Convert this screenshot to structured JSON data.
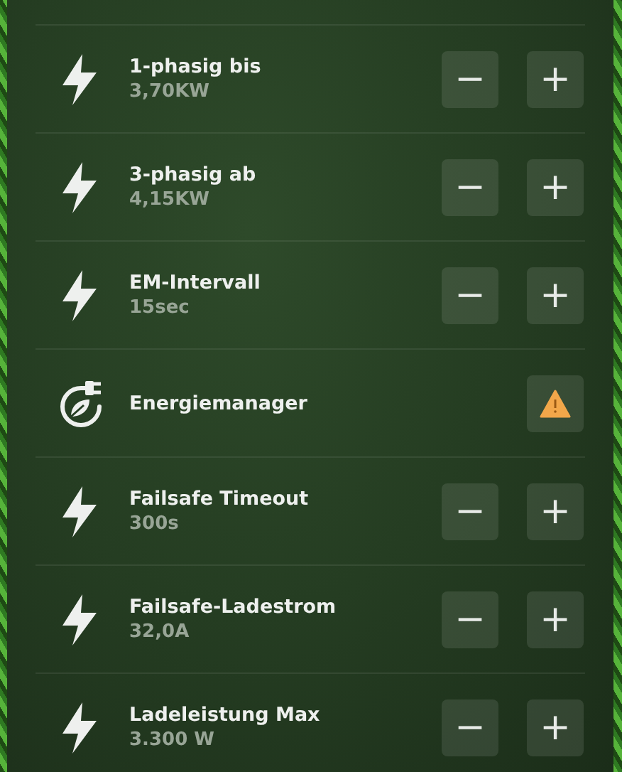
{
  "settings": [
    {
      "kind": "stepper",
      "title": "1-phasig bis",
      "value": "3,70KW",
      "minus": "−",
      "plus": "+"
    },
    {
      "kind": "stepper",
      "title": "3-phasig ab",
      "value": "4,15KW",
      "minus": "−",
      "plus": "+"
    },
    {
      "kind": "stepper",
      "title": "EM-Intervall",
      "value": "15sec",
      "minus": "−",
      "plus": "+"
    },
    {
      "kind": "warning",
      "title": "Energiemanager"
    },
    {
      "kind": "stepper",
      "title": "Failsafe Timeout",
      "value": "300s",
      "minus": "−",
      "plus": "+"
    },
    {
      "kind": "stepper",
      "title": "Failsafe-Ladestrom",
      "value": "32,0A",
      "minus": "−",
      "plus": "+"
    },
    {
      "kind": "stepper",
      "title": "Ladeleistung Max",
      "value": "3.300 W",
      "minus": "−",
      "plus": "+"
    }
  ]
}
